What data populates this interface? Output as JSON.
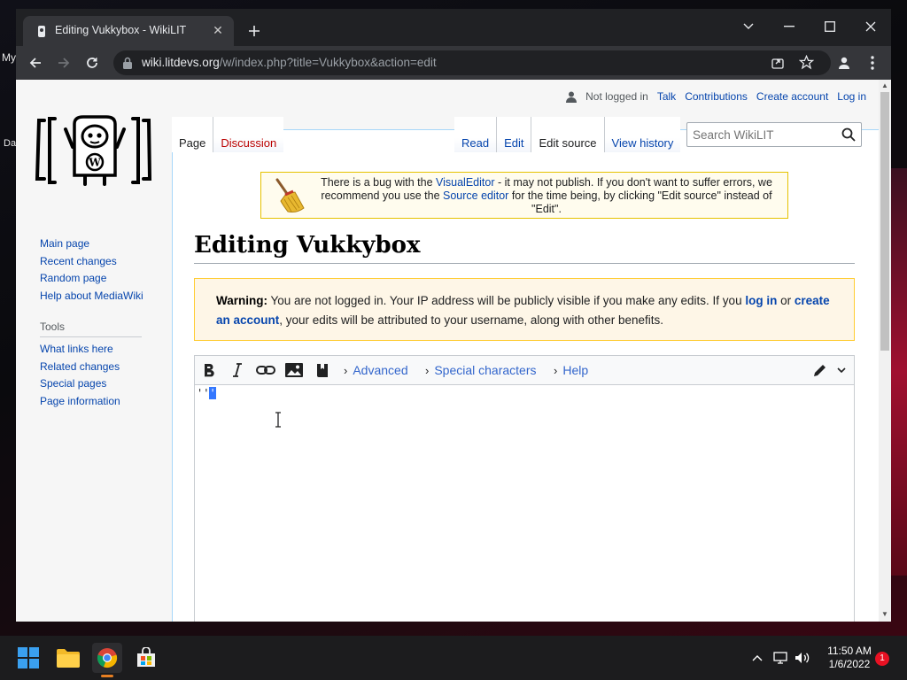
{
  "desktop": {
    "fragments": [
      "My",
      "Da"
    ]
  },
  "browser": {
    "tab_title": "Editing Vukkybox - WikiLIT",
    "url_host": "wiki.litdevs.org",
    "url_path": "/w/index.php?title=Vukkybox&action=edit"
  },
  "personal": {
    "not_logged_in": "Not logged in",
    "talk": "Talk",
    "contributions": "Contributions",
    "create_account": "Create account",
    "log_in": "Log in"
  },
  "tabs": {
    "page": "Page",
    "discussion": "Discussion",
    "read": "Read",
    "edit": "Edit",
    "edit_source": "Edit source",
    "view_history": "View history"
  },
  "search": {
    "placeholder": "Search WikiLIT"
  },
  "sidebar": {
    "nav": [
      "Main page",
      "Recent changes",
      "Random page",
      "Help about MediaWiki"
    ],
    "tools_heading": "Tools",
    "tools": [
      "What links here",
      "Related changes",
      "Special pages",
      "Page information"
    ]
  },
  "sitenotice": {
    "t1": "There is a bug with the ",
    "link1": "VisualEditor",
    "t2": " - it may not publish. If you don't want to suffer errors, we recommend you use the ",
    "link2": "Source editor",
    "t3": " for the time being, by clicking \"Edit source\" instead of \"Edit\"."
  },
  "heading": "Editing Vukkybox",
  "warning": {
    "label": "Warning:",
    "t1": " You are not logged in. Your IP address will be publicly visible if you make any edits. If you ",
    "link1": "log in",
    "t2": " or ",
    "link2": "create an account",
    "t3": ", your edits will be attributed to your username, along with other benefits."
  },
  "editor": {
    "advanced": "Advanced",
    "special_characters": "Special characters",
    "help": "Help",
    "text_plain": "''",
    "text_selected": "'"
  },
  "taskbar": {
    "time": "11:50 AM",
    "date": "1/6/2022",
    "notifications": "1"
  },
  "colors": {
    "link": "#0645ad",
    "new_link": "#ba0000",
    "warning_bg": "#fef6e7",
    "notice_bg": "#fffcee",
    "selection": "#3377ff"
  }
}
